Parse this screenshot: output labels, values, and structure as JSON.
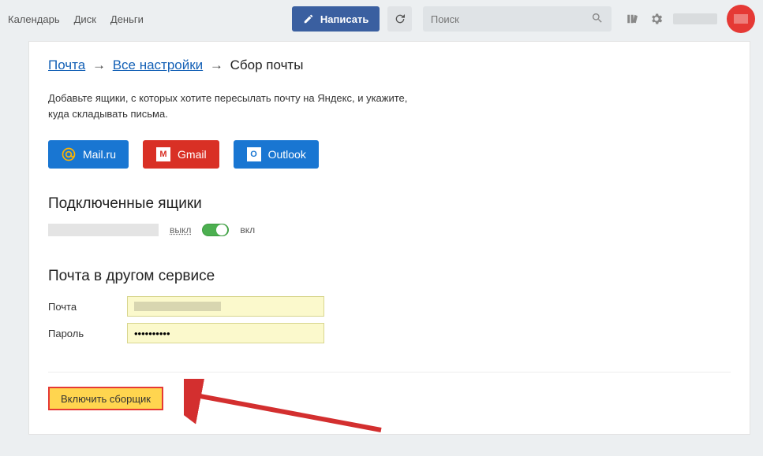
{
  "topnav": {
    "calendar": "Календарь",
    "disk": "Диск",
    "money": "Деньги"
  },
  "compose_label": "Написать",
  "search": {
    "placeholder": "Поиск"
  },
  "breadcrumb": {
    "mail": "Почта",
    "all_settings": "Все настройки",
    "current": "Сбор почты",
    "arrow": "→"
  },
  "intro_line1": "Добавьте ящики, с которых хотите пересылать почту на Яндекс, и укажите,",
  "intro_line2": "куда складывать письма.",
  "providers": {
    "mailru": "Mail.ru",
    "gmail": "Gmail",
    "outlook": "Outlook"
  },
  "connected_heading": "Подключенные ящики",
  "toggle": {
    "off": "выкл",
    "on": "вкл"
  },
  "other_service_heading": "Почта в другом сервисе",
  "form": {
    "email_label": "Почта",
    "password_label": "Пароль",
    "password_value": "••••••••••"
  },
  "enable_button": "Включить сборщик"
}
